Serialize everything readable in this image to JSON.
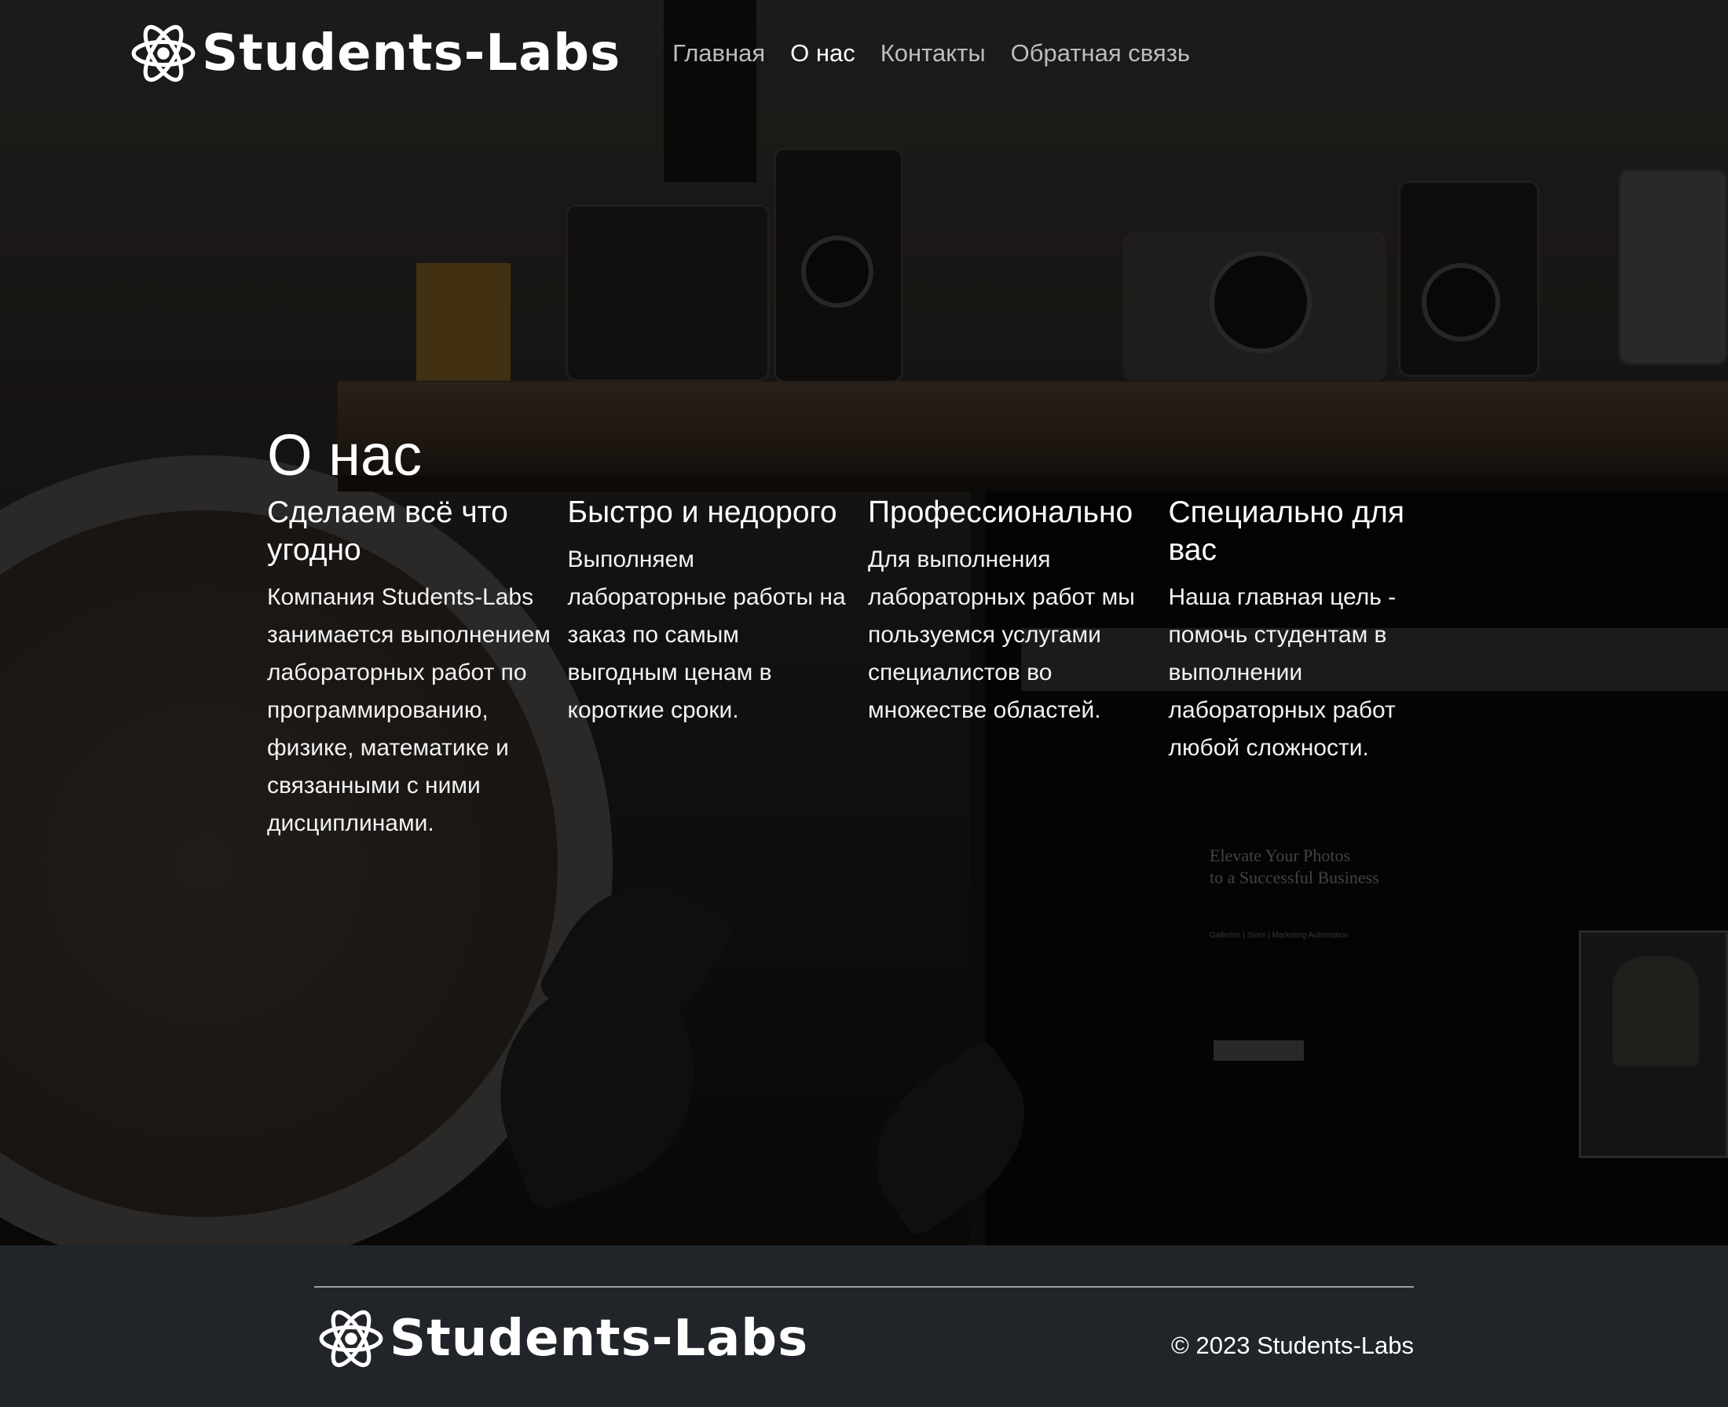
{
  "brand": {
    "name": "Students-Labs",
    "logo_icon": "atom-icon"
  },
  "nav": {
    "items": [
      {
        "label": "Главная",
        "active": false
      },
      {
        "label": "О нас",
        "active": true
      },
      {
        "label": "Контакты",
        "active": false
      },
      {
        "label": "Обратная связь",
        "active": false
      }
    ]
  },
  "about": {
    "title": "О нас",
    "columns": [
      {
        "heading": "Сделаем всё что угодно",
        "text": "Компания Students-Labs занимается выполнением лабораторных работ по программированию, физике, математике и связанными с ними дисциплинами."
      },
      {
        "heading": "Быстро и недорого",
        "text": "Выполняем лабораторные работы на заказ по самым выгодным ценам в короткие сроки."
      },
      {
        "heading": "Профессионально",
        "text": "Для выполнения лабораторных работ мы пользуемся услугами специалистов во множестве областей."
      },
      {
        "heading": "Специально для вас",
        "text": "Наша главная цель - помочь студентам в выполнении лабораторных работ любой сложности."
      }
    ]
  },
  "background_photo": {
    "promo_line1": "Elevate Your Photos",
    "promo_line2": "to a Successful Business",
    "promo_nav": "Galleries   |   Store   |   Marketing Automation"
  },
  "footer": {
    "brand_name": "Students-Labs",
    "copyright": "© 2023 Students-Labs"
  },
  "colors": {
    "footer_bg": "#212529",
    "nav_inactive": "#bdbdbd",
    "nav_active": "#ffffff"
  }
}
